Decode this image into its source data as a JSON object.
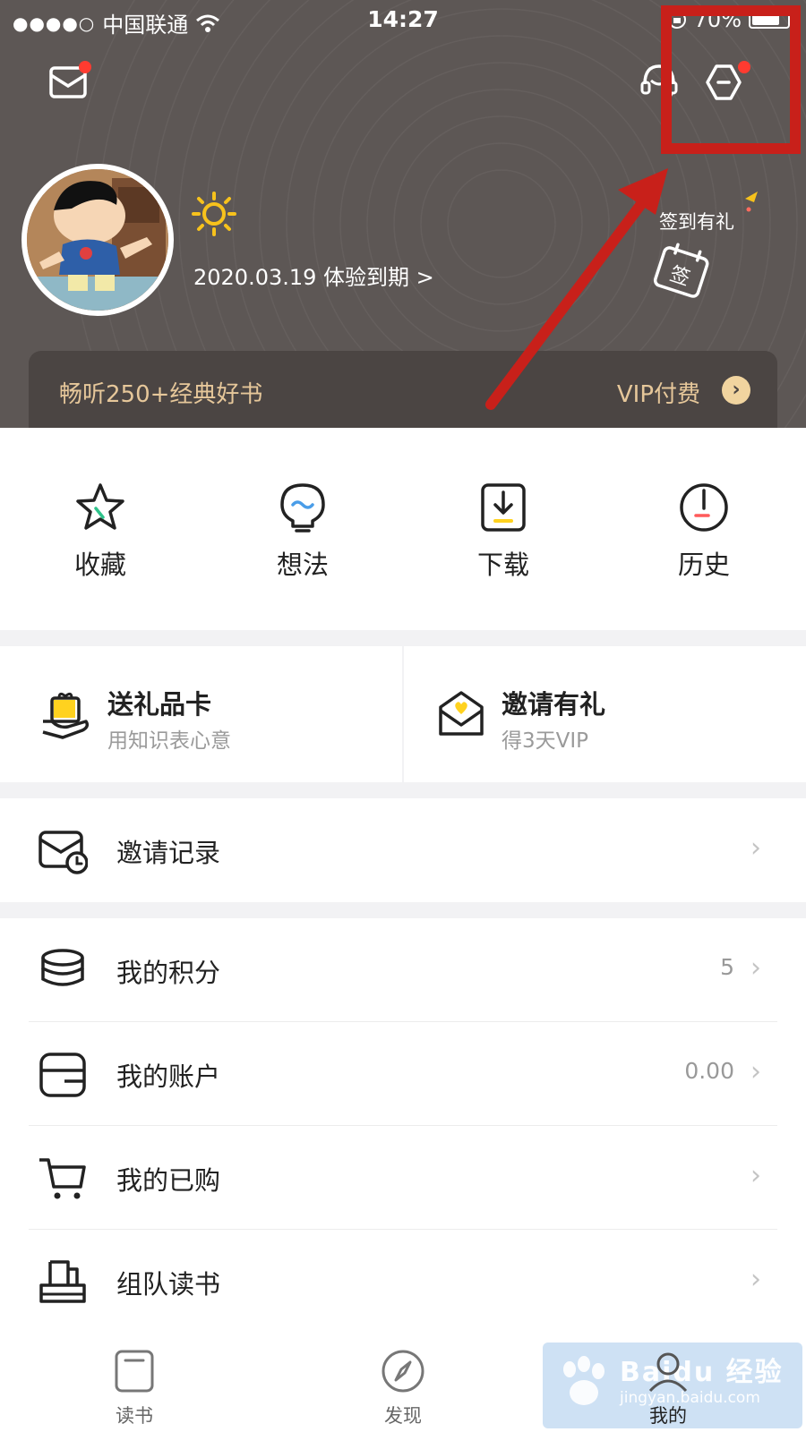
{
  "status_bar": {
    "signal": "●●●●○",
    "carrier": "中国联通",
    "time": "14:27",
    "battery": "70%"
  },
  "header": {
    "expire_text": "2020.03.19 体验到期 >",
    "checkin_label": "签到有礼",
    "checkin_icon_text": "签"
  },
  "vip_bar": {
    "promo": "畅听250+经典好书",
    "pay": "VIP付费"
  },
  "quick_actions": [
    {
      "label": "收藏",
      "icon": "star-icon"
    },
    {
      "label": "想法",
      "icon": "lightbulb-icon"
    },
    {
      "label": "下载",
      "icon": "download-icon"
    },
    {
      "label": "历史",
      "icon": "clock-icon"
    }
  ],
  "gifts": [
    {
      "title": "送礼品卡",
      "subtitle": "用知识表心意",
      "icon": "gift-card-icon"
    },
    {
      "title": "邀请有礼",
      "subtitle": "得3天VIP",
      "icon": "envelope-heart-icon"
    }
  ],
  "rows": {
    "invite_record": {
      "label": "邀请记录"
    },
    "points": {
      "label": "我的积分",
      "value": "5"
    },
    "account": {
      "label": "我的账户",
      "value": "0.00"
    },
    "purchased": {
      "label": "我的已购"
    },
    "team": {
      "label": "组队读书"
    }
  },
  "tab_bar": [
    {
      "label": "读书",
      "icon": "book-icon"
    },
    {
      "label": "发现",
      "icon": "compass-icon"
    },
    {
      "label": "我的",
      "icon": "user-icon",
      "active": true
    }
  ],
  "watermark": {
    "line1": "Baidu 经验",
    "line2": "jingyan.baidu.com"
  },
  "colors": {
    "header_bg": "#5d5755",
    "vip_gold": "#e6c79a",
    "accent_yellow": "#ffd21f",
    "badge_red": "#ff3b30",
    "annotation_red": "#c8201a"
  }
}
